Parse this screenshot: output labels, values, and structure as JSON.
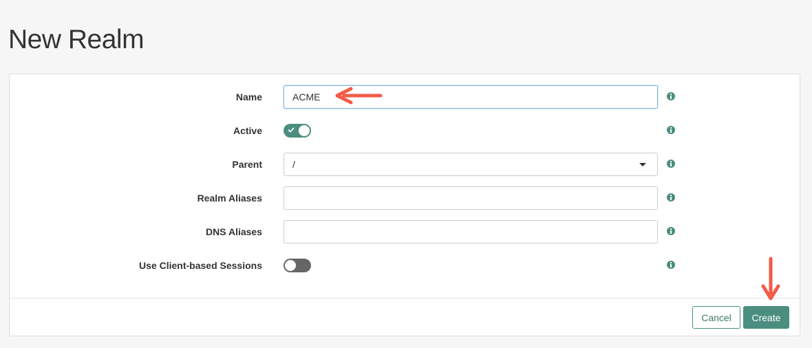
{
  "page": {
    "title": "New Realm"
  },
  "form": {
    "name": {
      "label": "Name",
      "value": "ACME"
    },
    "active": {
      "label": "Active",
      "enabled": true
    },
    "parent": {
      "label": "Parent",
      "selected": "/"
    },
    "realm_aliases": {
      "label": "Realm Aliases",
      "value": ""
    },
    "dns_aliases": {
      "label": "DNS Aliases",
      "value": ""
    },
    "client_sessions": {
      "label": "Use Client-based Sessions",
      "enabled": false
    }
  },
  "footer": {
    "cancel_label": "Cancel",
    "create_label": "Create"
  },
  "colors": {
    "accent": "#4b8e7f",
    "annotation": "#f25b48",
    "toggle_off": "#666666"
  },
  "icons": {
    "info": "info-icon",
    "check": "check-icon",
    "caret": "caret-down-icon",
    "arrow": "arrow-icon"
  }
}
